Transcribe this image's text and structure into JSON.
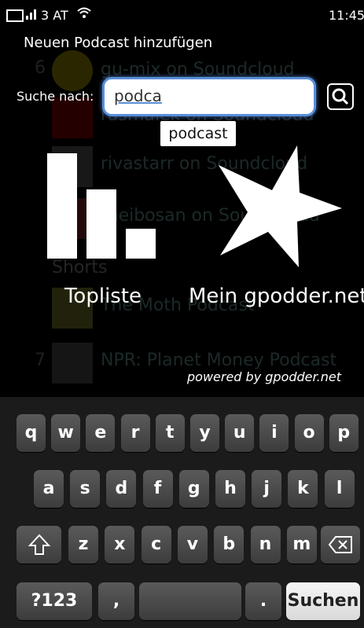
{
  "status_bar": {
    "carrier": "3 AT",
    "time": "11:45"
  },
  "background_list": {
    "rows": [
      {
        "num": "6",
        "title": "gu-mix on Soundcloud"
      },
      {
        "num": "",
        "title": "rasmalek on Soundcloud"
      },
      {
        "num": "",
        "title": "rivastarr on Soundcloud"
      },
      {
        "num": "",
        "title": "theibosan on Soundcloud"
      },
      {
        "num": "",
        "title": "The Moth Podcast"
      },
      {
        "num": "7",
        "title": "NPR: Planet Money Podcast"
      }
    ],
    "sections": [
      "Shorts"
    ]
  },
  "dialog": {
    "title": "Neuen Podcast hinzufügen",
    "search_label": "Suche nach:",
    "search_value": "podca",
    "suggestion": "podcast",
    "toplist_label": "Topliste",
    "gpodder_label": "Mein gpodder.net",
    "powered_by": "powered by gpodder.net",
    "toplist_bars": [
      1.0,
      0.66,
      0.28
    ]
  },
  "keyboard": {
    "row1": [
      "q",
      "w",
      "e",
      "r",
      "t",
      "y",
      "u",
      "i",
      "o",
      "p"
    ],
    "row2": [
      "a",
      "s",
      "d",
      "f",
      "g",
      "h",
      "j",
      "k",
      "l"
    ],
    "row3": [
      "z",
      "x",
      "c",
      "v",
      "b",
      "n",
      "m"
    ],
    "symbols_label": "?123",
    "comma": ",",
    "period": ".",
    "submit_label": "Suchen"
  }
}
